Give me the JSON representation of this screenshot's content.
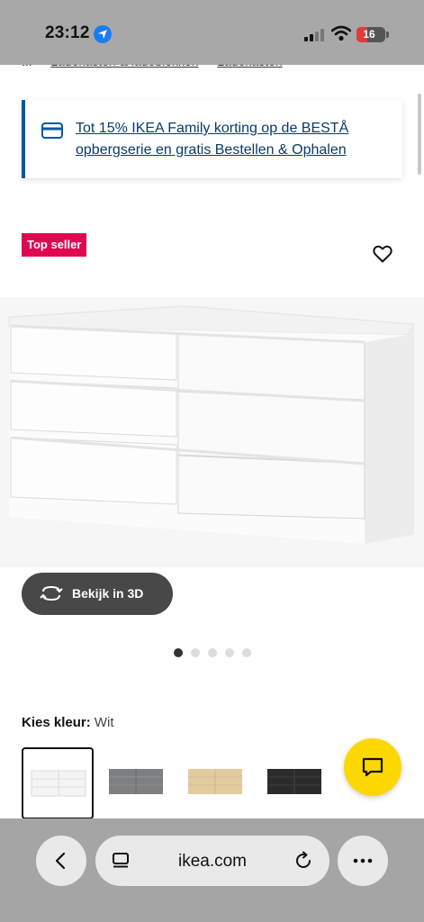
{
  "status_bar": {
    "time": "23:12",
    "battery": "16",
    "icons": [
      "location-icon",
      "signal-icon",
      "wifi-icon",
      "battery-icon"
    ]
  },
  "breadcrumb": {
    "items": [
      "...",
      "Ladekasten & ladeblokken",
      "Ladekasten"
    ]
  },
  "promo": {
    "text": "Tot 15% IKEA Family korting op de BESTÅ opbergserie en gratis Bestellen & Ophalen",
    "icon": "card-icon",
    "accent": "#0058a3"
  },
  "product": {
    "badge": "Top seller",
    "badge_color": "#e00751",
    "favorite_icon": "heart-icon",
    "view3d_label": "Bekijk in 3D",
    "image_count": 5,
    "active_image": 1
  },
  "color_selector": {
    "label": "Kies kleur:",
    "value": "Wit",
    "options": [
      {
        "name": "wit",
        "color": "#f4f4f2",
        "selected": true
      },
      {
        "name": "grijs",
        "color": "#7d7f82",
        "selected": false
      },
      {
        "name": "eiken",
        "color": "#e3cba0",
        "selected": false
      },
      {
        "name": "zwart",
        "color": "#2b2b2b",
        "selected": false
      }
    ]
  },
  "chat": {
    "icon": "chat-icon",
    "color": "#fdd800"
  },
  "browser": {
    "url": "ikea.com",
    "icons": [
      "back-icon",
      "tabs-icon",
      "reload-icon",
      "more-icon"
    ]
  }
}
